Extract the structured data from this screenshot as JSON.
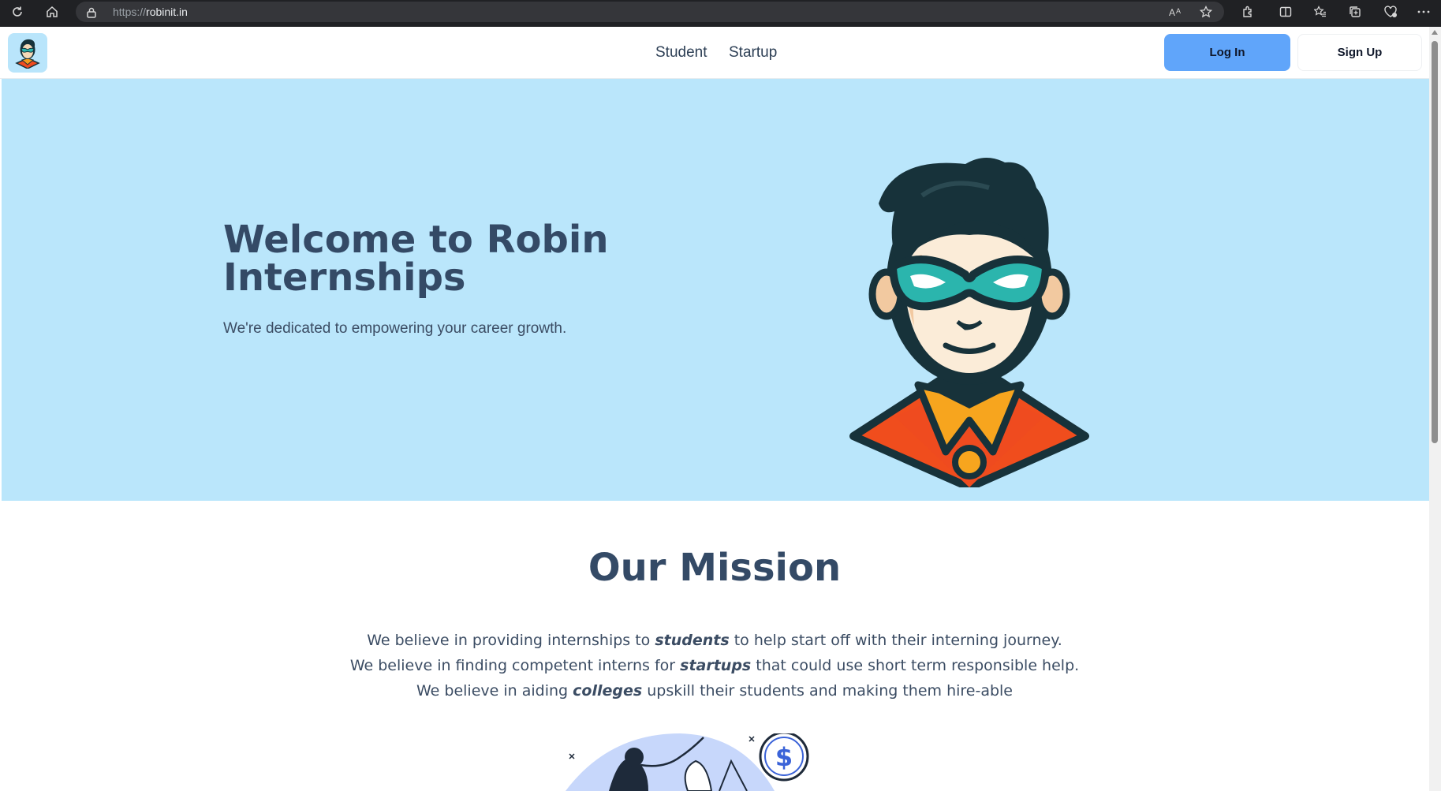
{
  "browser": {
    "url_scheme": "https://",
    "url_host": "robinit.in",
    "toolbar_icons": [
      "refresh-icon",
      "home-icon",
      "read-aloud-icon",
      "favorite-star-icon",
      "extensions-icon",
      "split-screen-icon",
      "favorites-icon",
      "collections-icon",
      "browser-essentials-icon",
      "more-icon"
    ]
  },
  "nav": {
    "links": [
      "Student",
      "Startup"
    ],
    "login_label": "Log In",
    "signup_label": "Sign Up"
  },
  "hero": {
    "title": "Welcome to Robin Internships",
    "subtitle": "We're dedicated to empowering your career growth."
  },
  "mission": {
    "title": "Our Mission",
    "line1_pre": "We believe in providing internships to ",
    "line1_em": "students",
    "line1_post": " to help start off with their interning journey.",
    "line2_pre": "We believe in finding competent interns for ",
    "line2_em": "startups",
    "line2_post": " that could use short term responsible help.",
    "line3_pre": "We believe in aiding ",
    "line3_em": "colleges",
    "line3_post": " upskill their students and making them hire-able"
  },
  "colors": {
    "hero_bg": "#bae6fb",
    "primary_button": "#60a5fa",
    "heading_text": "#344a66"
  }
}
